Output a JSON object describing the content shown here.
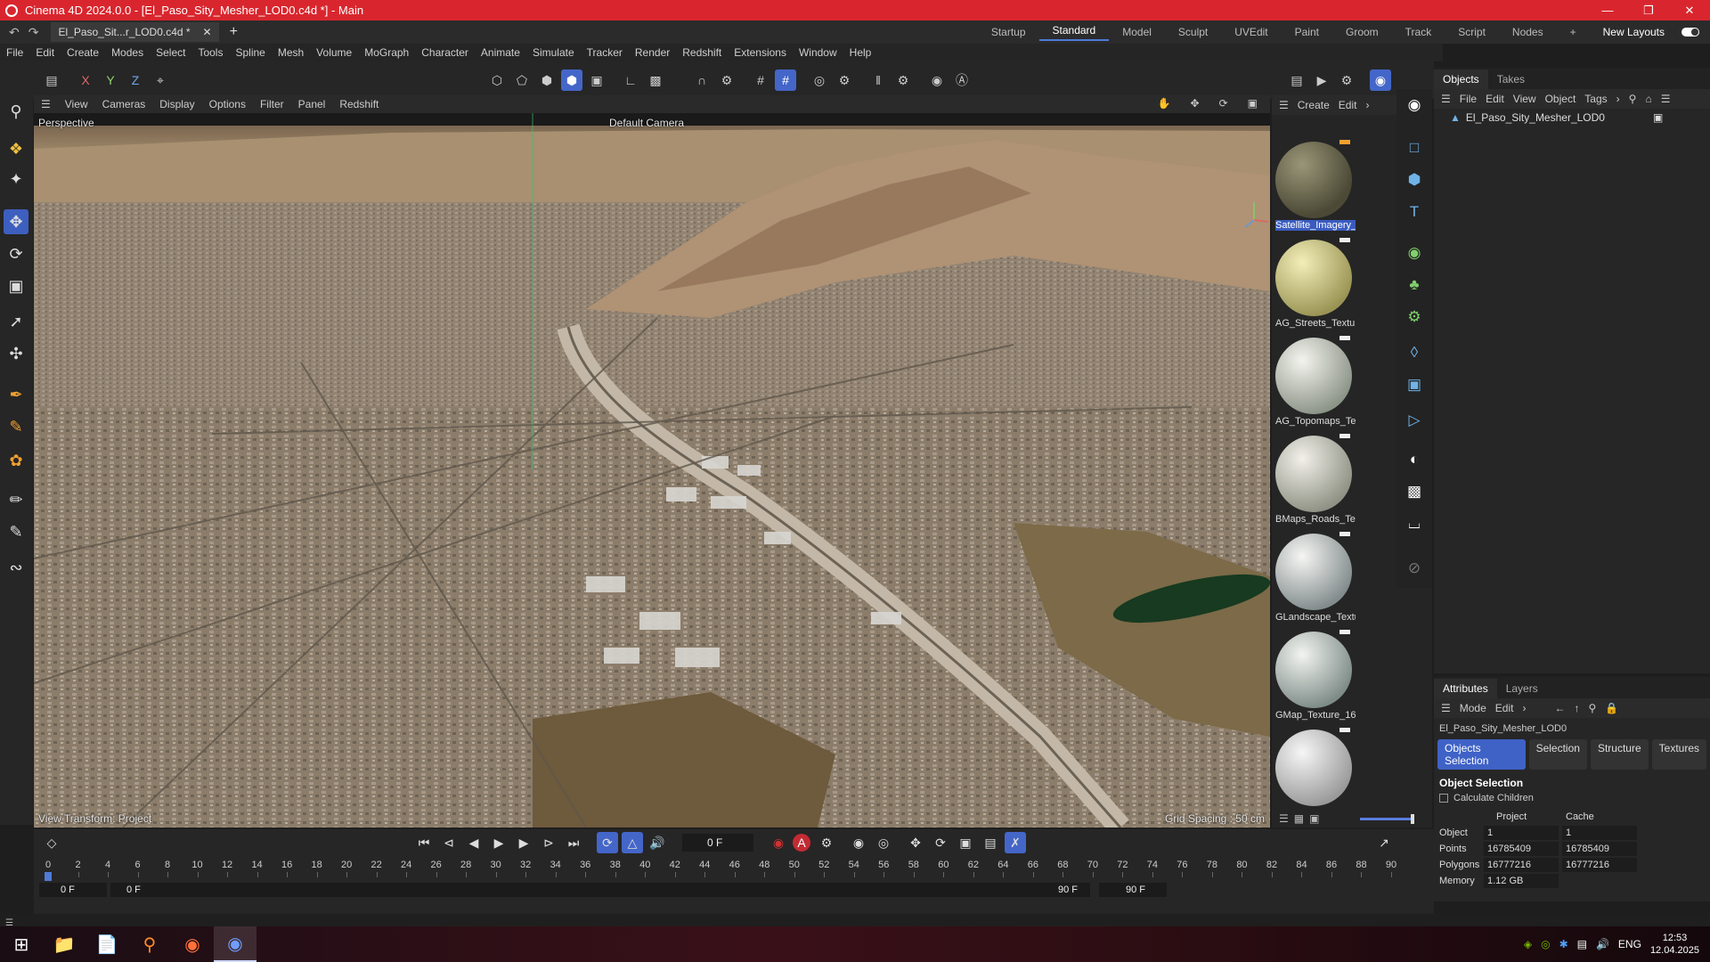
{
  "window": {
    "title": "Cinema 4D 2024.0.0 - [El_Paso_Sity_Mesher_LOD0.c4d *] - Main"
  },
  "doc_tab": {
    "label": "El_Paso_Sit...r_LOD0.c4d *"
  },
  "layouts": {
    "items": [
      "Startup",
      "Standard",
      "Model",
      "Sculpt",
      "UVEdit",
      "Paint",
      "Groom",
      "Track",
      "Script",
      "Nodes"
    ],
    "active": "Standard",
    "new_layouts": "New Layouts"
  },
  "menu": [
    "File",
    "Edit",
    "Create",
    "Modes",
    "Select",
    "Tools",
    "Spline",
    "Mesh",
    "Volume",
    "MoGraph",
    "Character",
    "Animate",
    "Simulate",
    "Tracker",
    "Render",
    "Redshift",
    "Extensions",
    "Window",
    "Help"
  ],
  "axis_tools": {
    "x": "X",
    "y": "Y",
    "z": "Z"
  },
  "viewport": {
    "menu": [
      "View",
      "Cameras",
      "Display",
      "Options",
      "Filter",
      "Panel",
      "Redshift"
    ],
    "name": "Perspective",
    "camera": "Default Camera",
    "hud_left": "View Transform: Project",
    "hud_right": "Grid Spacing : 50 cm"
  },
  "materials": {
    "menu": [
      "Create",
      "Edit"
    ],
    "items": [
      "Satellite_Imagery_",
      "AG_Streets_Textur",
      "AG_Topomaps_Te:",
      "BMaps_Roads_Tex",
      "GLandscape_Textu",
      "GMap_Texture_16",
      ""
    ],
    "selected": 0
  },
  "objects": {
    "tabs": [
      "Objects",
      "Takes"
    ],
    "menu": [
      "File",
      "Edit",
      "View",
      "Object",
      "Tags"
    ],
    "items": [
      "El_Paso_Sity_Mesher_LOD0"
    ]
  },
  "attributes": {
    "tabs": [
      "Attributes",
      "Layers"
    ],
    "menu": [
      "Mode",
      "Edit"
    ],
    "object_name": "El_Paso_Sity_Mesher_LOD0",
    "buttons": [
      "Objects Selection",
      "Selection",
      "Structure",
      "Textures"
    ],
    "section": "Object Selection",
    "checkbox": "Calculate Children",
    "col_project": "Project",
    "col_cache": "Cache",
    "rows": [
      {
        "label": "Object",
        "project": "1",
        "cache": "1"
      },
      {
        "label": "Points",
        "project": "16785409",
        "cache": "16785409"
      },
      {
        "label": "Polygons",
        "project": "16777216",
        "cache": "16777216"
      },
      {
        "label": "Memory",
        "project": "1.12 GB",
        "cache": ""
      }
    ]
  },
  "timeline": {
    "current_frame": "0 F",
    "ticks": [
      "0",
      "2",
      "4",
      "6",
      "8",
      "10",
      "12",
      "14",
      "16",
      "18",
      "20",
      "22",
      "24",
      "26",
      "28",
      "30",
      "32",
      "34",
      "36",
      "38",
      "40",
      "42",
      "44",
      "46",
      "48",
      "50",
      "52",
      "54",
      "56",
      "58",
      "60",
      "62",
      "64",
      "66",
      "68",
      "70",
      "72",
      "74",
      "76",
      "78",
      "80",
      "82",
      "84",
      "86",
      "88",
      "90"
    ],
    "range_start": "0 F",
    "range_start2": "0 F",
    "range_end": "90 F",
    "range_end2": "90 F"
  },
  "tray": {
    "lang": "ENG",
    "time": "12:53",
    "date": "12.04.2025"
  }
}
